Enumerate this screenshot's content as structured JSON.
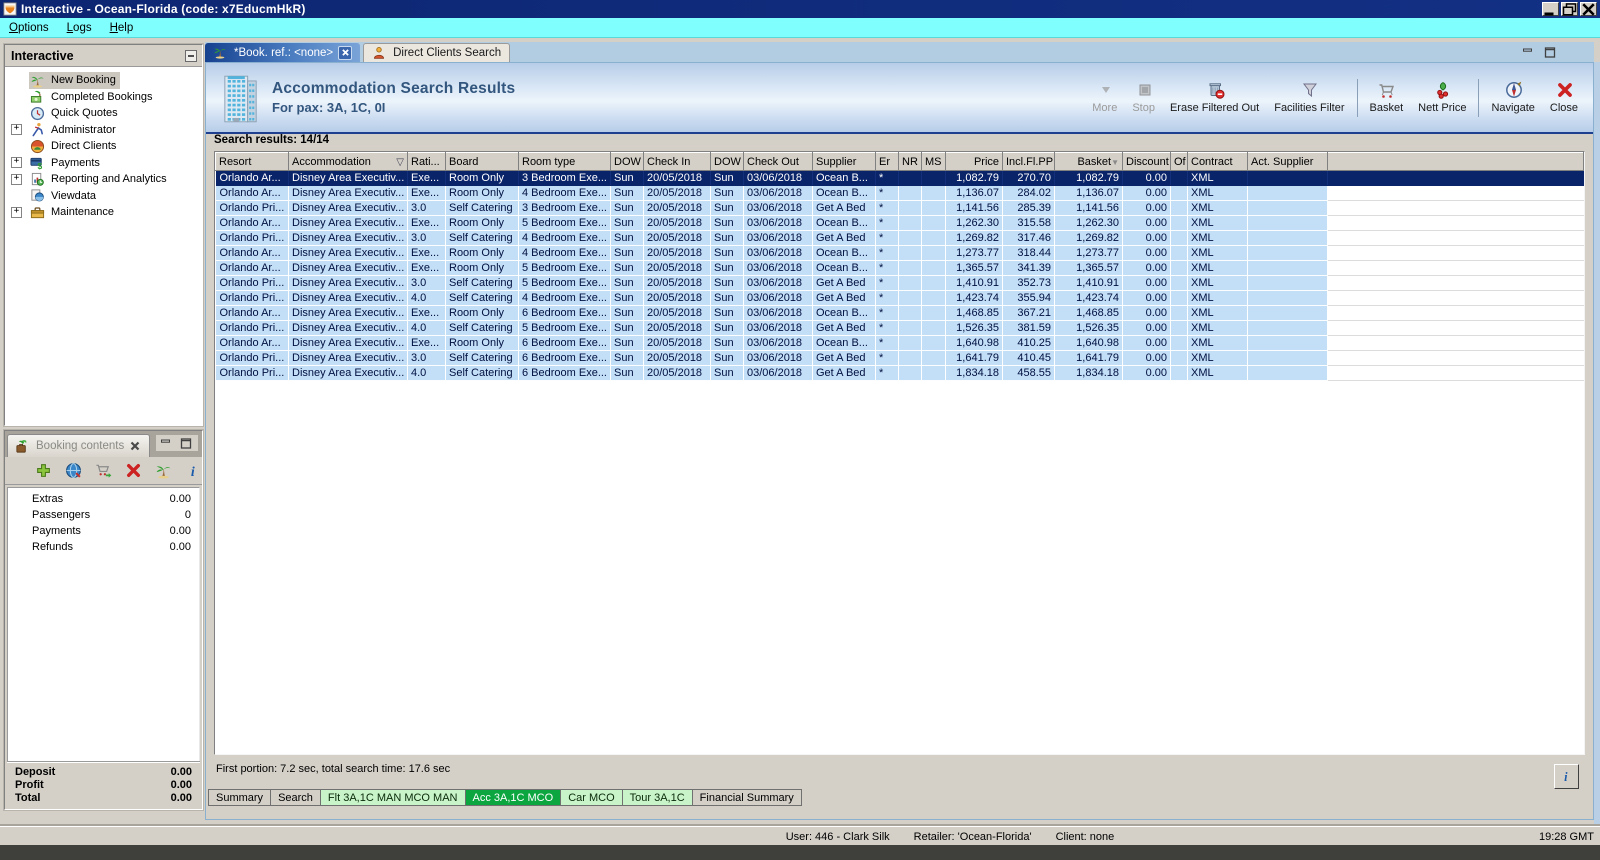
{
  "window": {
    "title": "Interactive - Ocean-Florida (code: x7EducmHkR)",
    "logo_icon": "app-logo",
    "menu": [
      "Options",
      "Logs",
      "Help"
    ],
    "buttons": [
      "minimize",
      "restore",
      "close"
    ]
  },
  "sidebar": {
    "title": "Interactive",
    "collapse_icon": "collapse-minus",
    "items": [
      {
        "label": "New Booking",
        "icon": "palm-tree",
        "selected": true
      },
      {
        "label": "Completed Bookings",
        "icon": "money-palm"
      },
      {
        "label": "Quick Quotes",
        "icon": "clock"
      },
      {
        "label": "Administrator",
        "icon": "runner",
        "expandable": true
      },
      {
        "label": "Direct Clients",
        "icon": "globe-people"
      },
      {
        "label": "Payments",
        "icon": "payments",
        "expandable": true
      },
      {
        "label": "Reporting and Analytics",
        "icon": "report",
        "expandable": true
      },
      {
        "label": "Viewdata",
        "icon": "viewdata"
      },
      {
        "label": "Maintenance",
        "icon": "toolbox",
        "expandable": true
      }
    ]
  },
  "booking_contents": {
    "tab_label": "Booking contents",
    "tab_icon": "booking-case",
    "close_icon": "grey-x",
    "window_controls": [
      "panel-minimize",
      "panel-maximize"
    ],
    "toolbar": [
      "add-plus",
      "world-clock",
      "cart-go",
      "delete-x",
      "palm-tree",
      "info"
    ],
    "rows": [
      {
        "label": "Extras",
        "value": "0.00"
      },
      {
        "label": "Passengers",
        "value": "0"
      },
      {
        "label": "Payments",
        "value": "0.00"
      },
      {
        "label": "Refunds",
        "value": "0.00"
      }
    ],
    "totals": [
      {
        "label": "Deposit",
        "value": "0.00"
      },
      {
        "label": "Profit",
        "value": "0.00"
      },
      {
        "label": "Total",
        "value": "0.00"
      }
    ]
  },
  "workspace": {
    "tabs": [
      {
        "label": "*Book. ref.: <none>",
        "icon": "palm-tree",
        "active": true
      },
      {
        "label": "Direct Clients Search",
        "icon": "person",
        "active": false
      }
    ],
    "window_controls": [
      "panel-minimize",
      "panel-maximize"
    ],
    "header": {
      "icon": "building",
      "title": "Accommodation Search Results",
      "subtitle": "For pax: 3A, 1C, 0I",
      "toolbar": [
        {
          "label": "More",
          "icon": "more-arrow",
          "disabled": true
        },
        {
          "label": "Stop",
          "icon": "stop-square",
          "disabled": true
        },
        {
          "label": "Erase Filtered Out",
          "icon": "erase-trash"
        },
        {
          "label": "Facilities Filter",
          "icon": "funnel"
        },
        {
          "type": "sep"
        },
        {
          "label": "Basket",
          "icon": "basket-cart"
        },
        {
          "label": "Nett Price",
          "icon": "nett-price"
        },
        {
          "type": "sep"
        },
        {
          "label": "Navigate",
          "icon": "navigate-compass"
        },
        {
          "label": "Close",
          "icon": "close-x"
        }
      ]
    },
    "results_count": "Search results: 14/14",
    "columns": [
      {
        "label": "Resort"
      },
      {
        "label": "Accommodation",
        "filter": true
      },
      {
        "label": "Rati..."
      },
      {
        "label": "Board"
      },
      {
        "label": "Room type"
      },
      {
        "label": "DOW"
      },
      {
        "label": "Check In"
      },
      {
        "label": "DOW"
      },
      {
        "label": "Check Out"
      },
      {
        "label": "Supplier"
      },
      {
        "label": "Er"
      },
      {
        "label": "NR"
      },
      {
        "label": "MS"
      },
      {
        "label": "Price"
      },
      {
        "label": "Incl.Fl.PP"
      },
      {
        "label": "Basket",
        "sort": true
      },
      {
        "label": "Discount"
      },
      {
        "label": "Of"
      },
      {
        "label": "Contract"
      },
      {
        "label": "Act. Supplier"
      }
    ],
    "rows": [
      {
        "selected": true,
        "cells": [
          "Orlando Ar...",
          "Disney Area Executiv...",
          "Exe...",
          "Room Only",
          "3 Bedroom Exe...",
          "Sun",
          "20/05/2018",
          "Sun",
          "03/06/2018",
          "Ocean B...",
          "*",
          "",
          "",
          "1,082.79",
          "270.70",
          "1,082.79",
          "0.00",
          "",
          "XML",
          ""
        ]
      },
      {
        "cells": [
          "Orlando Ar...",
          "Disney Area Executiv...",
          "Exe...",
          "Room Only",
          "4 Bedroom Exe...",
          "Sun",
          "20/05/2018",
          "Sun",
          "03/06/2018",
          "Ocean B...",
          "*",
          "",
          "",
          "1,136.07",
          "284.02",
          "1,136.07",
          "0.00",
          "",
          "XML",
          ""
        ]
      },
      {
        "cells": [
          "Orlando Pri...",
          "Disney Area Executiv...",
          "3.0",
          "Self Catering",
          "3 Bedroom Exe...",
          "Sun",
          "20/05/2018",
          "Sun",
          "03/06/2018",
          "Get A Bed",
          "*",
          "",
          "",
          "1,141.56",
          "285.39",
          "1,141.56",
          "0.00",
          "",
          "XML",
          ""
        ]
      },
      {
        "cells": [
          "Orlando Ar...",
          "Disney Area Executiv...",
          "Exe...",
          "Room Only",
          "5 Bedroom Exe...",
          "Sun",
          "20/05/2018",
          "Sun",
          "03/06/2018",
          "Ocean B...",
          "*",
          "",
          "",
          "1,262.30",
          "315.58",
          "1,262.30",
          "0.00",
          "",
          "XML",
          ""
        ]
      },
      {
        "cells": [
          "Orlando Pri...",
          "Disney Area Executiv...",
          "3.0",
          "Self Catering",
          "4 Bedroom Exe...",
          "Sun",
          "20/05/2018",
          "Sun",
          "03/06/2018",
          "Get A Bed",
          "*",
          "",
          "",
          "1,269.82",
          "317.46",
          "1,269.82",
          "0.00",
          "",
          "XML",
          ""
        ]
      },
      {
        "cells": [
          "Orlando Ar...",
          "Disney Area Executiv...",
          "Exe...",
          "Room Only",
          "4 Bedroom Exe...",
          "Sun",
          "20/05/2018",
          "Sun",
          "03/06/2018",
          "Ocean B...",
          "*",
          "",
          "",
          "1,273.77",
          "318.44",
          "1,273.77",
          "0.00",
          "",
          "XML",
          ""
        ]
      },
      {
        "cells": [
          "Orlando Ar...",
          "Disney Area Executiv...",
          "Exe...",
          "Room Only",
          "5 Bedroom Exe...",
          "Sun",
          "20/05/2018",
          "Sun",
          "03/06/2018",
          "Ocean B...",
          "*",
          "",
          "",
          "1,365.57",
          "341.39",
          "1,365.57",
          "0.00",
          "",
          "XML",
          ""
        ]
      },
      {
        "cells": [
          "Orlando Pri...",
          "Disney Area Executiv...",
          "3.0",
          "Self Catering",
          "5 Bedroom Exe...",
          "Sun",
          "20/05/2018",
          "Sun",
          "03/06/2018",
          "Get A Bed",
          "*",
          "",
          "",
          "1,410.91",
          "352.73",
          "1,410.91",
          "0.00",
          "",
          "XML",
          ""
        ]
      },
      {
        "cells": [
          "Orlando Pri...",
          "Disney Area Executiv...",
          "4.0",
          "Self Catering",
          "4 Bedroom Exe...",
          "Sun",
          "20/05/2018",
          "Sun",
          "03/06/2018",
          "Get A Bed",
          "*",
          "",
          "",
          "1,423.74",
          "355.94",
          "1,423.74",
          "0.00",
          "",
          "XML",
          ""
        ]
      },
      {
        "cells": [
          "Orlando Ar...",
          "Disney Area Executiv...",
          "Exe...",
          "Room Only",
          "6 Bedroom Exe...",
          "Sun",
          "20/05/2018",
          "Sun",
          "03/06/2018",
          "Ocean B...",
          "*",
          "",
          "",
          "1,468.85",
          "367.21",
          "1,468.85",
          "0.00",
          "",
          "XML",
          ""
        ]
      },
      {
        "cells": [
          "Orlando Pri...",
          "Disney Area Executiv...",
          "4.0",
          "Self Catering",
          "5 Bedroom Exe...",
          "Sun",
          "20/05/2018",
          "Sun",
          "03/06/2018",
          "Get A Bed",
          "*",
          "",
          "",
          "1,526.35",
          "381.59",
          "1,526.35",
          "0.00",
          "",
          "XML",
          ""
        ]
      },
      {
        "cells": [
          "Orlando Ar...",
          "Disney Area Executiv...",
          "Exe...",
          "Room Only",
          "6 Bedroom Exe...",
          "Sun",
          "20/05/2018",
          "Sun",
          "03/06/2018",
          "Ocean B...",
          "*",
          "",
          "",
          "1,640.98",
          "410.25",
          "1,640.98",
          "0.00",
          "",
          "XML",
          ""
        ]
      },
      {
        "cells": [
          "Orlando Pri...",
          "Disney Area Executiv...",
          "3.0",
          "Self Catering",
          "6 Bedroom Exe...",
          "Sun",
          "20/05/2018",
          "Sun",
          "03/06/2018",
          "Get A Bed",
          "*",
          "",
          "",
          "1,641.79",
          "410.45",
          "1,641.79",
          "0.00",
          "",
          "XML",
          ""
        ]
      },
      {
        "cells": [
          "Orlando Pri...",
          "Disney Area Executiv...",
          "4.0",
          "Self Catering",
          "6 Bedroom Exe...",
          "Sun",
          "20/05/2018",
          "Sun",
          "03/06/2018",
          "Get A Bed",
          "*",
          "",
          "",
          "1,834.18",
          "458.55",
          "1,834.18",
          "0.00",
          "",
          "XML",
          ""
        ]
      }
    ],
    "timing": "First portion: 7.2 sec, total search time: 17.6 sec",
    "info_icon": "info",
    "bottom_tabs": [
      {
        "label": "Summary",
        "type": "plain"
      },
      {
        "label": "Search",
        "type": "plain"
      },
      {
        "label": "Flt 3A,1C MAN MCO MAN",
        "type": "green"
      },
      {
        "label": "Acc 3A,1C MCO",
        "type": "green-active"
      },
      {
        "label": "Car MCO",
        "type": "green"
      },
      {
        "label": "Tour 3A,1C",
        "type": "green"
      },
      {
        "label": "Financial Summary",
        "type": "plain"
      }
    ]
  },
  "footer": {
    "user": "User: 446 - Clark Silk",
    "retailer": "Retailer: 'Ocean-Florida'",
    "client": "Client: none",
    "time": "19:28 GMT"
  },
  "colors": {
    "titlebar": "#0d2672",
    "menubar": "#80ffff",
    "selection_row": "#0a246a",
    "result_row_blue": "#c3def7",
    "active_bottom_tab_green": "#0ca641",
    "pale_green_tab": "#c9f3c9",
    "window_chrome_grey": "#d4d0c8"
  }
}
